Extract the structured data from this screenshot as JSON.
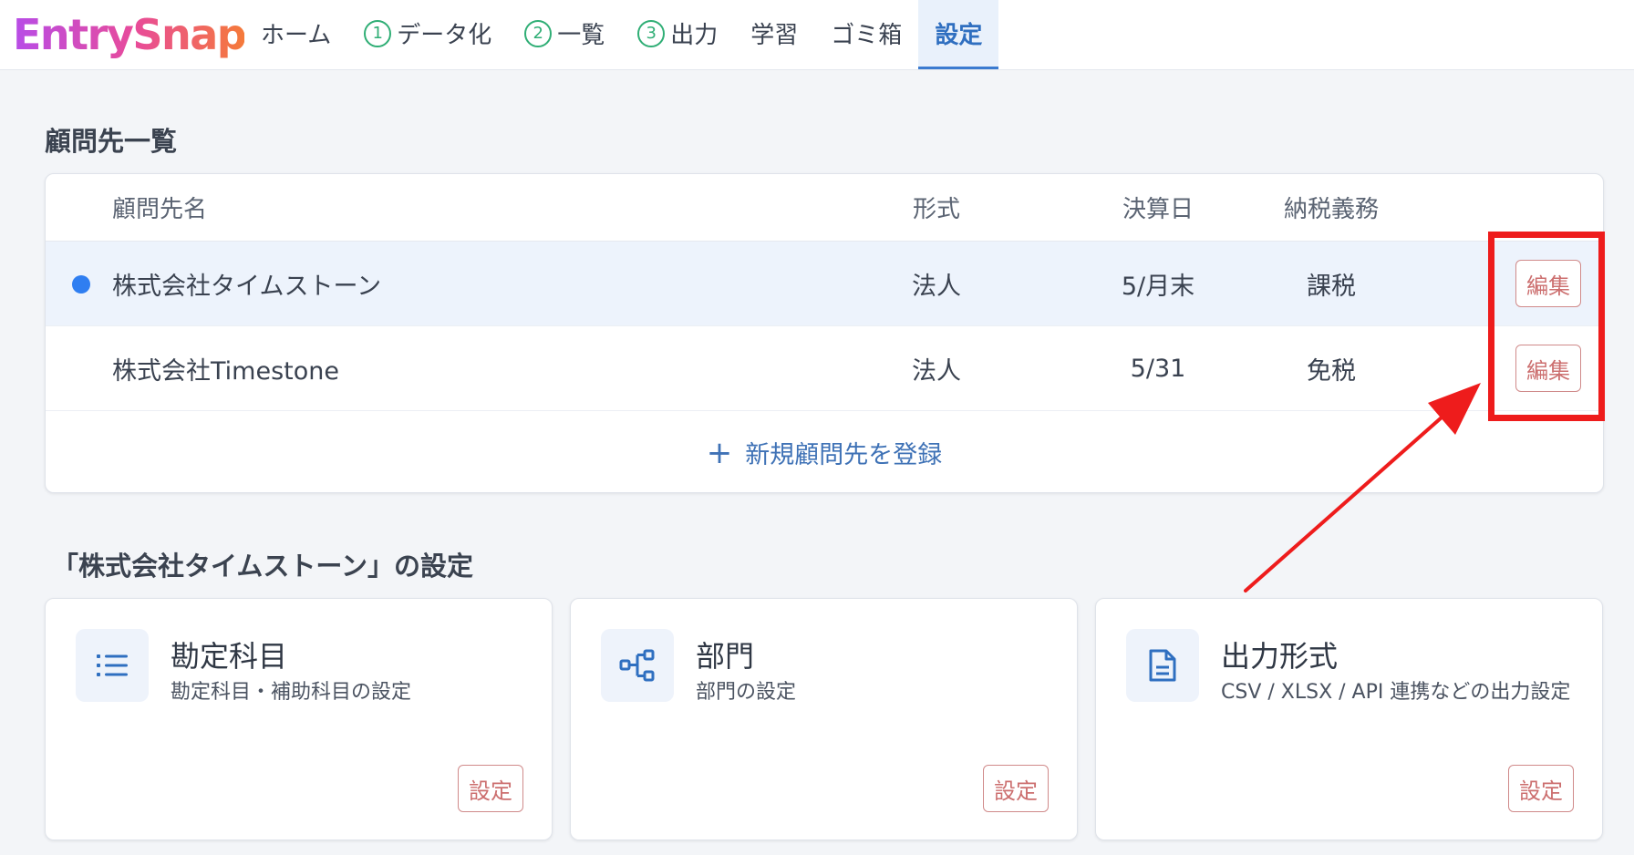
{
  "app": {
    "logo_text": "EntrySnap"
  },
  "nav": {
    "tabs": [
      {
        "label": "ホーム",
        "number": ""
      },
      {
        "label": "データ化",
        "number": "1"
      },
      {
        "label": "一覧",
        "number": "2"
      },
      {
        "label": "出力",
        "number": "3"
      },
      {
        "label": "学習",
        "number": ""
      },
      {
        "label": "ゴミ箱",
        "number": ""
      },
      {
        "label": "設定",
        "number": "",
        "active": true
      }
    ]
  },
  "clients": {
    "section_title": "顧問先一覧",
    "columns": {
      "name": "顧問先名",
      "type": "形式",
      "fiscal_end": "決算日",
      "tax": "納税義務"
    },
    "rows": [
      {
        "name": "株式会社タイムストーン",
        "type": "法人",
        "fiscal_end": "5/月末",
        "tax": "課税",
        "edit_label": "編集",
        "selected": true
      },
      {
        "name": "株式会社Timestone",
        "type": "法人",
        "fiscal_end": "5/31",
        "tax": "免税",
        "edit_label": "編集",
        "selected": false
      }
    ],
    "add_label": "新規顧問先を登録"
  },
  "settings": {
    "section_title": "「株式会社タイムストーン」の設定",
    "cards": [
      {
        "title": "勘定科目",
        "desc": "勘定科目・補助科目の設定",
        "button": "設定",
        "icon": "list-icon"
      },
      {
        "title": "部門",
        "desc": "部門の設定",
        "button": "設定",
        "icon": "org-chart-icon"
      },
      {
        "title": "出力形式",
        "desc": "CSV / XLSX / API 連携などの出力設定",
        "button": "設定",
        "icon": "document-icon"
      }
    ]
  },
  "colors": {
    "accent": "#3b7bd0",
    "selected_row_bg": "#edf3fc",
    "outline_button": "#cc6f6f",
    "annotation": "#ee1c1c",
    "step_circle": "#2fae75"
  }
}
